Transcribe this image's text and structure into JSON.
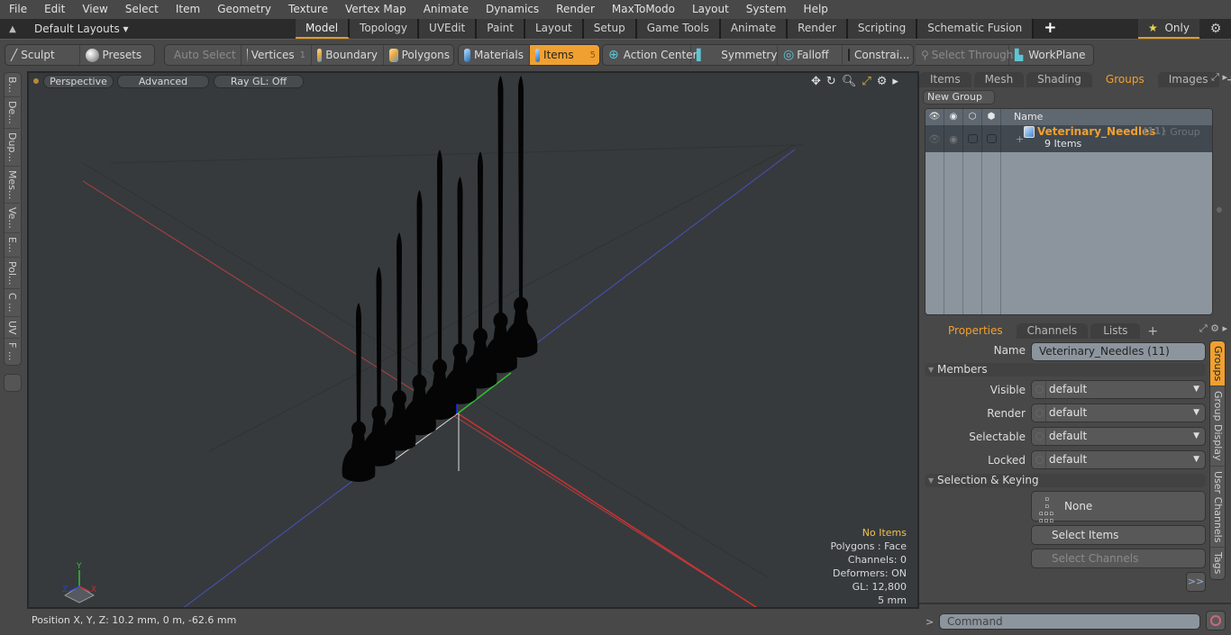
{
  "menu": [
    "File",
    "Edit",
    "View",
    "Select",
    "Item",
    "Geometry",
    "Texture",
    "Vertex Map",
    "Animate",
    "Dynamics",
    "Render",
    "MaxToModo",
    "Layout",
    "System",
    "Help"
  ],
  "layout_bar": {
    "layouts_label": "Default Layouts ▾",
    "tabs": [
      "Model",
      "Topology",
      "UVEdit",
      "Paint",
      "Layout",
      "Setup",
      "Game Tools",
      "Animate",
      "Render",
      "Scripting",
      "Schematic Fusion"
    ],
    "active_tab": "Model",
    "add_tab": "+",
    "only_label": "Only"
  },
  "toolbar": {
    "sculpt": "Sculpt",
    "presets": "Presets",
    "auto_select": "Auto Select",
    "vertices": "Vertices",
    "vertices_count": "1",
    "boundary": "Boundary",
    "polygons": "Polygons",
    "materials": "Materials",
    "items": "Items",
    "items_count": "5",
    "action_center": "Action Center",
    "symmetry": "Symmetry",
    "falloff": "Falloff",
    "constraints": "Constrai...",
    "select_through": "Select Through",
    "workplane": "WorkPlane"
  },
  "left_tabs": [
    "B...",
    "De...",
    "Dup...",
    "Mes...",
    "Ve...",
    "E...",
    "Pol...",
    "C ...",
    "UV",
    "F ..."
  ],
  "viewport": {
    "view_mode": "Perspective",
    "shading": "Advanced",
    "raygl": "Ray GL: Off",
    "info": {
      "selection": "No Items",
      "polygons": "Polygons : Face",
      "channels": "Channels: 0",
      "deformers": "Deformers: ON",
      "gl": "GL: 12,800",
      "grid": "5 mm"
    },
    "axis_labels": {
      "x": "X",
      "y": "Y",
      "z": "Z"
    },
    "needle_count": 9
  },
  "status": {
    "position": "Position X, Y, Z:   10.2 mm, 0 m, -62.6 mm"
  },
  "groups_panel": {
    "tabs": [
      "Items",
      "Mesh ...",
      "Shading",
      "Groups",
      "Images"
    ],
    "active_tab": "Groups",
    "new_group": "New Group",
    "column_name": "Name",
    "group": {
      "name": "Veterinary_Needles",
      "count": "(11)",
      "type": ": Group",
      "items": "9 Items"
    }
  },
  "properties_panel": {
    "tabs": [
      "Properties",
      "Channels",
      "Lists"
    ],
    "active_tab": "Properties",
    "name_label": "Name",
    "name_value": "Veterinary_Needles (11)",
    "members_section": "Members",
    "fields": [
      {
        "label": "Visible",
        "value": "default"
      },
      {
        "label": "Render",
        "value": "default"
      },
      {
        "label": "Selectable",
        "value": "default"
      },
      {
        "label": "Locked",
        "value": "default"
      }
    ],
    "selection_section": "Selection & Keying",
    "none_button": "None",
    "select_items": "Select Items",
    "select_channels": "Select Channels",
    "more": ">>",
    "side_tabs": [
      "Groups",
      "Group Display",
      "User Channels",
      "Tags"
    ],
    "active_side_tab": "Groups"
  },
  "command": {
    "prompt": ">",
    "placeholder": "Command"
  },
  "colors": {
    "accent": "#f0a030",
    "group_name": "#f0a030",
    "axis_x": "#d03030",
    "axis_y": "#30c030",
    "axis_z": "#3040d0"
  }
}
